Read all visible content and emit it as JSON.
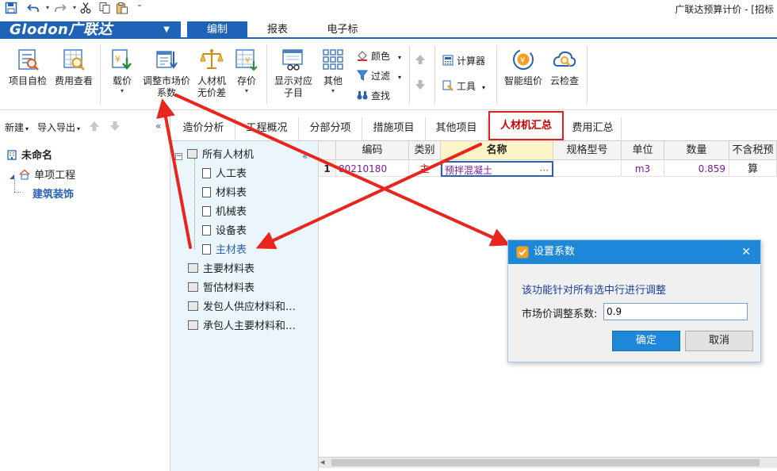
{
  "window": {
    "title": "广联达预算计价 - [招标"
  },
  "brand": {
    "logo_text": "Glodon广联达"
  },
  "ribbon_tabs": [
    {
      "label": "编制",
      "active": true
    },
    {
      "label": "报表",
      "active": false
    },
    {
      "label": "电子标",
      "active": false
    }
  ],
  "ribbon": {
    "project_check": "项目自检",
    "cost_view": "费用查看",
    "price_load": "载价",
    "adjust_market_line1": "调整市场价",
    "adjust_market_line2": "系数",
    "labor_machine_line1": "人材机",
    "labor_machine_line2": "无价差",
    "store_price": "存价",
    "show_sub_line1": "显示对应",
    "show_sub_line2": "子目",
    "other": "其他",
    "color": "颜色",
    "filter": "过滤",
    "find": "查找",
    "calculator": "计算器",
    "tools": "工具",
    "smart_price": "智能组价",
    "cloud_check": "云检查"
  },
  "left_toolbar": {
    "new": "新建",
    "import_export": "导入导出"
  },
  "project_tree": {
    "root": "未命名",
    "single": "单项工程",
    "unit": "建筑装饰"
  },
  "main_tabs": [
    {
      "label": "造价分析",
      "active": false
    },
    {
      "label": "工程概况",
      "active": false
    },
    {
      "label": "分部分项",
      "active": false
    },
    {
      "label": "措施项目",
      "active": false
    },
    {
      "label": "其他项目",
      "active": false
    },
    {
      "label": "人材机汇总",
      "active": true
    },
    {
      "label": "费用汇总",
      "active": false
    }
  ],
  "category_tree": {
    "all": "所有人材机",
    "labor": "人工表",
    "material": "材料表",
    "machine": "机械表",
    "equipment": "设备表",
    "main_material": "主材表",
    "key_material": "主要材料表",
    "provisional_material": "暂估材料表",
    "owner_supply": "发包人供应材料和…",
    "contractor_main": "承包人主要材料和…"
  },
  "grid": {
    "columns": [
      "编码",
      "类别",
      "名称",
      "规格型号",
      "单位",
      "数量",
      "不含税预算"
    ],
    "rows": [
      {
        "index": "1",
        "code": "80210180",
        "category": "主",
        "name": "预拌混凝土",
        "spec": "",
        "unit": "m3",
        "qty": "0.859",
        "price": ""
      }
    ],
    "ellipsis": "···"
  },
  "dialog": {
    "title": "设置系数",
    "close": "✕",
    "message": "该功能针对所有选中行进行调整",
    "field_label": "市场价调整系数:",
    "field_value": "0.9",
    "ok": "确定",
    "cancel": "取消"
  },
  "colors": {
    "brand_blue": "#1e63b8",
    "dialog_blue": "#1e88d8",
    "annotation_red": "#e8261e"
  }
}
